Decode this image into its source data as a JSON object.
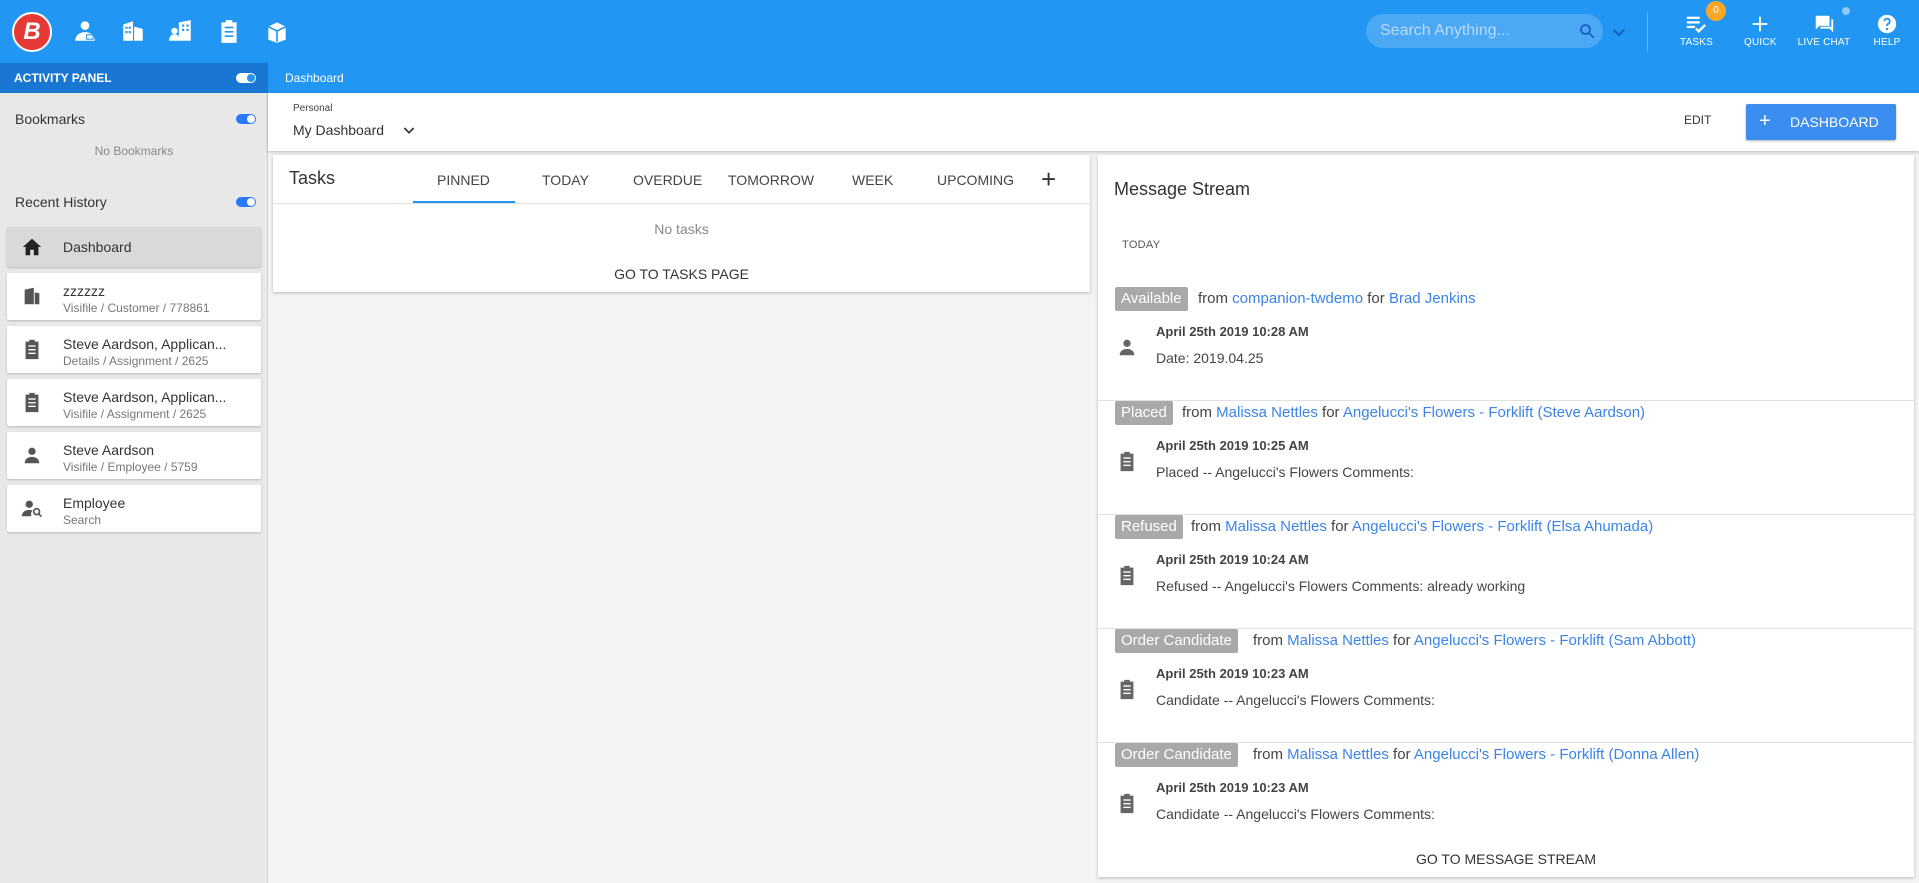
{
  "topbar": {
    "logo_letter": "B",
    "search_placeholder": "Search Anything...",
    "tasks_label": "TASKS",
    "tasks_count": "0",
    "quick_label": "QUICK",
    "live_chat_label": "LIVE CHAT",
    "help_label": "HELP"
  },
  "activity_panel": {
    "title": "ACTIVITY PANEL"
  },
  "breadcrumb": "Dashboard",
  "sidebar": {
    "bookmarks_title": "Bookmarks",
    "bookmarks_empty": "No Bookmarks",
    "recent_title": "Recent History",
    "items": [
      {
        "title": "Dashboard",
        "subtitle": "",
        "icon": "home-icon"
      },
      {
        "title": "zzzzzz",
        "subtitle": "Visifile / Customer / 778861",
        "icon": "building-icon"
      },
      {
        "title": "Steve Aardson, Applican...",
        "subtitle": "Details / Assignment / 2625",
        "icon": "clipboard-icon"
      },
      {
        "title": "Steve Aardson, Applican...",
        "subtitle": "Visifile / Assignment / 2625",
        "icon": "clipboard-icon"
      },
      {
        "title": "Steve Aardson",
        "subtitle": "Visifile / Employee / 5759",
        "icon": "person-icon"
      },
      {
        "title": "Employee",
        "subtitle": "Search",
        "icon": "person-search-icon"
      }
    ]
  },
  "dashboard": {
    "personal_label": "Personal",
    "selected": "My Dashboard",
    "edit_label": "EDIT",
    "add_label": "DASHBOARD"
  },
  "tasks": {
    "title": "Tasks",
    "tabs": [
      "PINNED",
      "TODAY",
      "OVERDUE",
      "TOMORROW",
      "WEEK",
      "UPCOMING"
    ],
    "empty": "No tasks",
    "goto": "GO TO TASKS PAGE"
  },
  "messages": {
    "title": "Message Stream",
    "group": "TODAY",
    "goto": "GO TO MESSAGE STREAM",
    "items": [
      {
        "status": "Available",
        "from_word": "from",
        "from": "companion-twdemo",
        "for_word": "for",
        "target": "Brad Jenkins",
        "date": "April 25th 2019 10:28 AM",
        "body": "Date: 2019.04.25",
        "icon": "person-icon"
      },
      {
        "status": "Placed",
        "from_word": "from",
        "from": "Malissa Nettles",
        "for_word": "for",
        "target": "Angelucci's Flowers - Forklift (Steve Aardson)",
        "date": "April 25th 2019 10:25 AM",
        "body": "Placed -- Angelucci's Flowers Comments:",
        "icon": "clipboard-icon"
      },
      {
        "status": "Refused",
        "from_word": "from",
        "from": "Malissa Nettles",
        "for_word": "for",
        "target": "Angelucci's Flowers - Forklift (Elsa Ahumada)",
        "date": "April 25th 2019 10:24 AM",
        "body": "Refused -- Angelucci's Flowers Comments: already working",
        "icon": "clipboard-icon"
      },
      {
        "status": "Order Candidate",
        "from_word": "from",
        "from": "Malissa Nettles",
        "for_word": "for",
        "target": "Angelucci's Flowers - Forklift (Sam Abbott)",
        "date": "April 25th 2019 10:23 AM",
        "body": "Candidate -- Angelucci's Flowers Comments:",
        "icon": "clipboard-icon"
      },
      {
        "status": "Order Candidate",
        "from_word": "from",
        "from": "Malissa Nettles",
        "for_word": "for",
        "target": "Angelucci's Flowers - Forklift (Donna Allen)",
        "date": "April 25th 2019 10:23 AM",
        "body": "Candidate -- Angelucci's Flowers Comments:",
        "icon": "clipboard-icon"
      }
    ]
  },
  "colors": {
    "topbar": "#2196f3",
    "panel_header": "#1976d2",
    "accent": "#3b8ef0",
    "link": "#3b84e8",
    "badge_gray": "#a9a9a9",
    "task_badge": "#f9a825"
  }
}
